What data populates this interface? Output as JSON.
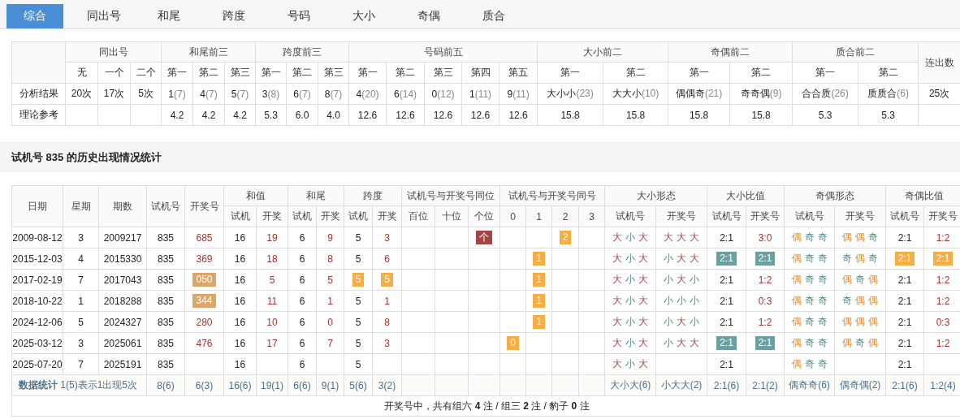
{
  "tabs": [
    {
      "label": "综合",
      "selected": true
    },
    {
      "label": "同出号",
      "selected": false
    },
    {
      "label": "和尾",
      "selected": false
    },
    {
      "label": "跨度",
      "selected": false
    },
    {
      "label": "号码",
      "selected": false
    },
    {
      "label": "大小",
      "selected": false
    },
    {
      "label": "奇偶",
      "selected": false
    },
    {
      "label": "质合",
      "selected": false
    }
  ],
  "summary": {
    "header_rows": [
      [
        {
          "text": null,
          "rowspan": 2
        },
        {
          "text": "同出号",
          "colspan": 3
        },
        {
          "text": "和尾前三",
          "colspan": 3
        },
        {
          "text": "跨度前三",
          "colspan": 3
        },
        {
          "text": "号码前五",
          "colspan": 5
        },
        {
          "text": "大小前二",
          "colspan": 2
        },
        {
          "text": "奇偶前二",
          "colspan": 2
        },
        {
          "text": "质合前二",
          "colspan": 2
        },
        {
          "text": "连出数",
          "rowspan": 2
        }
      ],
      [
        {
          "text": "无"
        },
        {
          "text": "一个"
        },
        {
          "text": "二个"
        },
        {
          "text": "第一"
        },
        {
          "text": "第二"
        },
        {
          "text": "第三"
        },
        {
          "text": "第一"
        },
        {
          "text": "第二"
        },
        {
          "text": "第三"
        },
        {
          "text": "第一"
        },
        {
          "text": "第二"
        },
        {
          "text": "第三"
        },
        {
          "text": "第四"
        },
        {
          "text": "第五"
        },
        {
          "text": "第一"
        },
        {
          "text": "第二"
        },
        {
          "text": "第一"
        },
        {
          "text": "第二"
        },
        {
          "text": "第一"
        },
        {
          "text": "第二"
        }
      ]
    ],
    "rows": [
      {
        "label": "分析结果",
        "cells": [
          {
            "value": "20次"
          },
          {
            "value": "17次"
          },
          {
            "value": "5次"
          },
          {
            "value": "1",
            "count": "(7)"
          },
          {
            "value": "4",
            "count": "(7)"
          },
          {
            "value": "5",
            "count": "(7)"
          },
          {
            "value": "3",
            "count": "(8)"
          },
          {
            "value": "6",
            "count": "(7)"
          },
          {
            "value": "8",
            "count": "(7)"
          },
          {
            "value": "4",
            "count": "(20)"
          },
          {
            "value": "6",
            "count": "(14)"
          },
          {
            "value": "0",
            "count": "(12)"
          },
          {
            "value": "1",
            "count": "(11)"
          },
          {
            "value": "9",
            "count": "(11)"
          },
          {
            "value": "大小小",
            "count": "(23)"
          },
          {
            "value": "大大小",
            "count": "(10)"
          },
          {
            "value": "偶偶奇",
            "count": "(21)"
          },
          {
            "value": "奇奇偶",
            "count": "(9)"
          },
          {
            "value": "合合质",
            "count": "(26)"
          },
          {
            "value": "质质合",
            "count": "(6)"
          },
          {
            "value": "25次"
          }
        ]
      },
      {
        "label": "理论参考",
        "cells": [
          null,
          null,
          null,
          {
            "value": "4.2"
          },
          {
            "value": "4.2"
          },
          {
            "value": "4.2"
          },
          {
            "value": "5.3"
          },
          {
            "value": "6.0"
          },
          {
            "value": "4.0"
          },
          {
            "value": "12.6"
          },
          {
            "value": "12.6"
          },
          {
            "value": "12.6"
          },
          {
            "value": "12.6"
          },
          {
            "value": "12.6"
          },
          {
            "value": "15.8"
          },
          {
            "value": "15.8"
          },
          {
            "value": "15.8"
          },
          {
            "value": "15.8"
          },
          {
            "value": "5.3"
          },
          {
            "value": "5.3"
          },
          null
        ]
      }
    ]
  },
  "section_title": "试机号 835 的历史出现情况统计",
  "history": {
    "header_rows": [
      [
        {
          "text": "日期",
          "rowspan": 2
        },
        {
          "text": "星期",
          "rowspan": 2
        },
        {
          "text": "期数",
          "rowspan": 2
        },
        {
          "text": "试机号",
          "rowspan": 2
        },
        {
          "text": "开奖号",
          "rowspan": 2
        },
        {
          "text": "和值",
          "colspan": 2
        },
        {
          "text": "和尾",
          "colspan": 2
        },
        {
          "text": "跨度",
          "colspan": 2
        },
        {
          "text": "试机号与开奖号同位",
          "colspan": 3
        },
        {
          "text": "试机号与开奖号同号",
          "colspan": 4
        },
        {
          "text": "大小形态",
          "colspan": 2
        },
        {
          "text": "大小比值",
          "colspan": 2
        },
        {
          "text": "奇偶形态",
          "colspan": 2
        },
        {
          "text": "奇偶比值",
          "colspan": 2
        }
      ],
      [
        {
          "text": "试机"
        },
        {
          "text": "开奖"
        },
        {
          "text": "试机"
        },
        {
          "text": "开奖"
        },
        {
          "text": "试机"
        },
        {
          "text": "开奖"
        },
        {
          "text": "百位"
        },
        {
          "text": "十位"
        },
        {
          "text": "个位"
        },
        {
          "text": "0"
        },
        {
          "text": "1"
        },
        {
          "text": "2"
        },
        {
          "text": "3"
        },
        {
          "text": "试机号"
        },
        {
          "text": "开奖号"
        },
        {
          "text": "试机号"
        },
        {
          "text": "开奖号"
        },
        {
          "text": "试机号"
        },
        {
          "text": "开奖号"
        },
        {
          "text": "试机号"
        },
        {
          "text": "开奖号"
        }
      ]
    ],
    "rows": [
      [
        {
          "text": "2009-08-12"
        },
        {
          "text": "3"
        },
        {
          "text": "2009217"
        },
        {
          "text": "835"
        },
        {
          "text": "685",
          "kind": "hit"
        },
        {
          "text": "16"
        },
        {
          "text": "19",
          "kind": "hit"
        },
        {
          "text": "6"
        },
        {
          "text": "9",
          "kind": "hit"
        },
        {
          "text": "5"
        },
        {
          "text": "3",
          "kind": "hit"
        },
        null,
        null,
        {
          "text": "个",
          "kind": "badge",
          "color": "#a34545"
        },
        null,
        null,
        {
          "text": "2",
          "kind": "badge",
          "color": "#f5ad45"
        },
        null,
        {
          "chars": [
            {
              "text": "大",
              "kind": "big"
            },
            {
              "text": "小",
              "kind": "small"
            },
            {
              "text": "大",
              "kind": "big"
            }
          ]
        },
        {
          "chars": [
            {
              "text": "大",
              "kind": "big"
            },
            {
              "text": "大",
              "kind": "big"
            },
            {
              "text": "大",
              "kind": "big"
            }
          ]
        },
        {
          "text": "2:1"
        },
        {
          "text": "3:0",
          "kind": "hit"
        },
        {
          "chars": [
            {
              "text": "偶",
              "kind": "even"
            },
            {
              "text": "奇",
              "kind": "odd"
            },
            {
              "text": "奇",
              "kind": "odd"
            }
          ]
        },
        {
          "chars": [
            {
              "text": "偶",
              "kind": "even"
            },
            {
              "text": "偶",
              "kind": "even"
            },
            {
              "text": "奇",
              "kind": "odd"
            }
          ]
        },
        {
          "text": "2:1"
        },
        {
          "text": "1:2",
          "kind": "hit"
        }
      ],
      [
        {
          "text": "2015-12-03"
        },
        {
          "text": "4"
        },
        {
          "text": "2015330"
        },
        {
          "text": "835"
        },
        {
          "text": "369",
          "kind": "hit"
        },
        {
          "text": "16"
        },
        {
          "text": "18",
          "kind": "hit"
        },
        {
          "text": "6"
        },
        {
          "text": "8",
          "kind": "hit"
        },
        {
          "text": "5"
        },
        {
          "text": "6",
          "kind": "hit"
        },
        null,
        null,
        null,
        null,
        {
          "text": "1",
          "kind": "badge",
          "color": "#f5ad45"
        },
        null,
        null,
        {
          "chars": [
            {
              "text": "大",
              "kind": "big"
            },
            {
              "text": "小",
              "kind": "small"
            },
            {
              "text": "大",
              "kind": "big"
            }
          ]
        },
        {
          "chars": [
            {
              "text": "小",
              "kind": "small"
            },
            {
              "text": "大",
              "kind": "big"
            },
            {
              "text": "大",
              "kind": "big"
            }
          ]
        },
        {
          "text": "2:1",
          "kind": "badge",
          "color": "#6e9fa0"
        },
        {
          "text": "2:1",
          "kind": "badge",
          "color": "#6e9fa0"
        },
        {
          "chars": [
            {
              "text": "偶",
              "kind": "even"
            },
            {
              "text": "奇",
              "kind": "odd"
            },
            {
              "text": "奇",
              "kind": "odd"
            }
          ]
        },
        {
          "chars": [
            {
              "text": "奇",
              "kind": "odd"
            },
            {
              "text": "偶",
              "kind": "even"
            },
            {
              "text": "奇",
              "kind": "odd"
            }
          ]
        },
        {
          "text": "2:1",
          "kind": "badge",
          "color": "#f5ad45"
        },
        {
          "text": "2:1",
          "kind": "badge",
          "color": "#f5ad45"
        }
      ],
      [
        {
          "text": "2017-02-19"
        },
        {
          "text": "7"
        },
        {
          "text": "2017043"
        },
        {
          "text": "835"
        },
        {
          "text": "050",
          "kind": "badge",
          "color": "#dca66a"
        },
        {
          "text": "16"
        },
        {
          "text": "5",
          "kind": "hit"
        },
        {
          "text": "6"
        },
        {
          "text": "5",
          "kind": "hit"
        },
        {
          "text": "5",
          "kind": "badge",
          "color": "#f5ad45"
        },
        {
          "text": "5",
          "kind": "badge",
          "color": "#f5ad45"
        },
        null,
        null,
        null,
        null,
        {
          "text": "1",
          "kind": "badge",
          "color": "#f5ad45"
        },
        null,
        null,
        {
          "chars": [
            {
              "text": "大",
              "kind": "big"
            },
            {
              "text": "小",
              "kind": "small"
            },
            {
              "text": "大",
              "kind": "big"
            }
          ]
        },
        {
          "chars": [
            {
              "text": "小",
              "kind": "small"
            },
            {
              "text": "大",
              "kind": "big"
            },
            {
              "text": "小",
              "kind": "small"
            }
          ]
        },
        {
          "text": "2:1"
        },
        {
          "text": "1:2",
          "kind": "hit"
        },
        {
          "chars": [
            {
              "text": "偶",
              "kind": "even"
            },
            {
              "text": "奇",
              "kind": "odd"
            },
            {
              "text": "奇",
              "kind": "odd"
            }
          ]
        },
        {
          "chars": [
            {
              "text": "偶",
              "kind": "even"
            },
            {
              "text": "奇",
              "kind": "odd"
            },
            {
              "text": "偶",
              "kind": "even"
            }
          ]
        },
        {
          "text": "2:1"
        },
        {
          "text": "1:2",
          "kind": "hit"
        }
      ],
      [
        {
          "text": "2018-10-22"
        },
        {
          "text": "1"
        },
        {
          "text": "2018288"
        },
        {
          "text": "835"
        },
        {
          "text": "344",
          "kind": "badge",
          "color": "#dca66a"
        },
        {
          "text": "16"
        },
        {
          "text": "11",
          "kind": "hit"
        },
        {
          "text": "6"
        },
        {
          "text": "1",
          "kind": "hit"
        },
        {
          "text": "5"
        },
        {
          "text": "1",
          "kind": "hit"
        },
        null,
        null,
        null,
        null,
        {
          "text": "1",
          "kind": "badge",
          "color": "#f5ad45"
        },
        null,
        null,
        {
          "chars": [
            {
              "text": "大",
              "kind": "big"
            },
            {
              "text": "小",
              "kind": "small"
            },
            {
              "text": "大",
              "kind": "big"
            }
          ]
        },
        {
          "chars": [
            {
              "text": "小",
              "kind": "small"
            },
            {
              "text": "小",
              "kind": "small"
            },
            {
              "text": "小",
              "kind": "small"
            }
          ]
        },
        {
          "text": "2:1"
        },
        {
          "text": "0:3",
          "kind": "hit"
        },
        {
          "chars": [
            {
              "text": "偶",
              "kind": "even"
            },
            {
              "text": "奇",
              "kind": "odd"
            },
            {
              "text": "奇",
              "kind": "odd"
            }
          ]
        },
        {
          "chars": [
            {
              "text": "奇",
              "kind": "odd"
            },
            {
              "text": "偶",
              "kind": "even"
            },
            {
              "text": "偶",
              "kind": "even"
            }
          ]
        },
        {
          "text": "2:1"
        },
        {
          "text": "1:2",
          "kind": "hit"
        }
      ],
      [
        {
          "text": "2024-12-06"
        },
        {
          "text": "5"
        },
        {
          "text": "2024327"
        },
        {
          "text": "835"
        },
        {
          "text": "280",
          "kind": "hit"
        },
        {
          "text": "16"
        },
        {
          "text": "10",
          "kind": "hit"
        },
        {
          "text": "6"
        },
        {
          "text": "0",
          "kind": "hit"
        },
        {
          "text": "5"
        },
        {
          "text": "8",
          "kind": "hit"
        },
        null,
        null,
        null,
        null,
        {
          "text": "1",
          "kind": "badge",
          "color": "#f5ad45"
        },
        null,
        null,
        {
          "chars": [
            {
              "text": "大",
              "kind": "big"
            },
            {
              "text": "小",
              "kind": "small"
            },
            {
              "text": "大",
              "kind": "big"
            }
          ]
        },
        {
          "chars": [
            {
              "text": "小",
              "kind": "small"
            },
            {
              "text": "大",
              "kind": "big"
            },
            {
              "text": "小",
              "kind": "small"
            }
          ]
        },
        {
          "text": "2:1"
        },
        {
          "text": "1:2",
          "kind": "hit"
        },
        {
          "chars": [
            {
              "text": "偶",
              "kind": "even"
            },
            {
              "text": "奇",
              "kind": "odd"
            },
            {
              "text": "奇",
              "kind": "odd"
            }
          ]
        },
        {
          "chars": [
            {
              "text": "偶",
              "kind": "even"
            },
            {
              "text": "偶",
              "kind": "even"
            },
            {
              "text": "偶",
              "kind": "even"
            }
          ]
        },
        {
          "text": "2:1"
        },
        {
          "text": "0:3",
          "kind": "hit"
        }
      ],
      [
        {
          "text": "2025-03-12"
        },
        {
          "text": "3"
        },
        {
          "text": "2025061"
        },
        {
          "text": "835"
        },
        {
          "text": "476",
          "kind": "hit"
        },
        {
          "text": "16"
        },
        {
          "text": "17",
          "kind": "hit"
        },
        {
          "text": "6"
        },
        {
          "text": "7",
          "kind": "hit"
        },
        {
          "text": "5"
        },
        {
          "text": "3",
          "kind": "hit"
        },
        null,
        null,
        null,
        {
          "text": "0",
          "kind": "badge",
          "color": "#f5ad45"
        },
        null,
        null,
        null,
        {
          "chars": [
            {
              "text": "大",
              "kind": "big"
            },
            {
              "text": "小",
              "kind": "small"
            },
            {
              "text": "大",
              "kind": "big"
            }
          ]
        },
        {
          "chars": [
            {
              "text": "小",
              "kind": "small"
            },
            {
              "text": "大",
              "kind": "big"
            },
            {
              "text": "大",
              "kind": "big"
            }
          ]
        },
        {
          "text": "2:1",
          "kind": "badge",
          "color": "#6e9fa0"
        },
        {
          "text": "2:1",
          "kind": "badge",
          "color": "#6e9fa0"
        },
        {
          "chars": [
            {
              "text": "偶",
              "kind": "even"
            },
            {
              "text": "奇",
              "kind": "odd"
            },
            {
              "text": "奇",
              "kind": "odd"
            }
          ]
        },
        {
          "chars": [
            {
              "text": "偶",
              "kind": "even"
            },
            {
              "text": "奇",
              "kind": "odd"
            },
            {
              "text": "偶",
              "kind": "even"
            }
          ]
        },
        {
          "text": "2:1"
        },
        {
          "text": "1:2",
          "kind": "hit"
        }
      ],
      [
        {
          "text": "2025-07-20"
        },
        {
          "text": "7"
        },
        {
          "text": "2025191"
        },
        {
          "text": "835"
        },
        null,
        {
          "text": "16"
        },
        null,
        {
          "text": "6"
        },
        null,
        {
          "text": "5"
        },
        null,
        null,
        null,
        null,
        null,
        null,
        null,
        null,
        {
          "chars": [
            {
              "text": "大",
              "kind": "big"
            },
            {
              "text": "小",
              "kind": "small"
            },
            {
              "text": "大",
              "kind": "big"
            }
          ]
        },
        null,
        {
          "text": "2:1"
        },
        null,
        {
          "chars": [
            {
              "text": "偶",
              "kind": "even"
            },
            {
              "text": "奇",
              "kind": "odd"
            },
            {
              "text": "奇",
              "kind": "odd"
            }
          ]
        },
        null,
        {
          "text": "2:1"
        },
        null
      ]
    ],
    "stats": {
      "label": "**数据统计** 1(5)表示1出现5次",
      "cells": [
        "8(6)",
        "6(3)",
        "16(6)",
        "19(1)",
        "6(6)",
        "9(1)",
        "5(6)",
        "3(2)",
        null,
        null,
        null,
        null,
        null,
        null,
        null,
        "大小大(6)",
        "小大大(2)",
        "2:1(6)",
        "2:1(2)",
        "偶奇奇(6)",
        "偶奇偶(2)",
        "2:1(6)",
        "1:2(4)"
      ]
    },
    "footer": "开奖号中，共有组六 **4** 注 / 组三 **2** 注 / 豹子 **0** 注"
  }
}
